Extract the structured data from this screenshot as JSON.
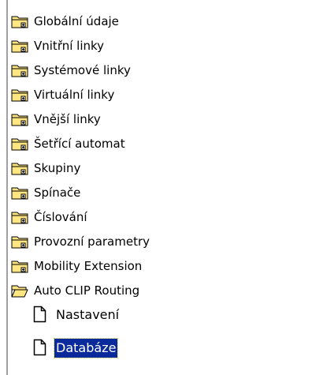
{
  "tree": {
    "folders": [
      {
        "label": "Globální údaje",
        "expanded": false
      },
      {
        "label": "Vnitřní linky",
        "expanded": false
      },
      {
        "label": "Systémové linky",
        "expanded": false
      },
      {
        "label": "Virtuální linky",
        "expanded": false
      },
      {
        "label": "Vnější linky",
        "expanded": false
      },
      {
        "label": "Šetřící automat",
        "expanded": false
      },
      {
        "label": "Skupiny",
        "expanded": false
      },
      {
        "label": "Spínače",
        "expanded": false
      },
      {
        "label": "Číslování",
        "expanded": false
      },
      {
        "label": "Provozní parametry",
        "expanded": false
      },
      {
        "label": "Mobility Extension",
        "expanded": false
      },
      {
        "label": "Auto CLIP Routing",
        "expanded": true
      }
    ],
    "children": [
      {
        "label": "Nastavení",
        "selected": false
      },
      {
        "label": "Databáze",
        "selected": true
      }
    ]
  },
  "colors": {
    "folder_fill": "#ffe680",
    "folder_outline": "#000000",
    "selection_background": "#0a2a9c",
    "selection_text": "#ffffff",
    "tree_border": "#a0a0a0"
  },
  "icons": {
    "collapsed_folder": "closed-folder-icon",
    "expanded_folder": "open-folder-icon",
    "document": "document-icon"
  }
}
